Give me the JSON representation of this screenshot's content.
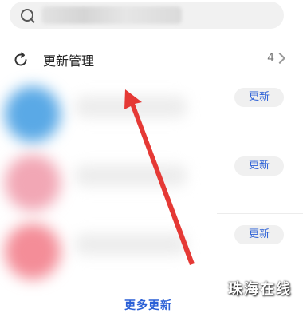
{
  "search": {
    "icon": "search-icon"
  },
  "manage": {
    "icon": "refresh-icon",
    "title": "更新管理",
    "count": "4",
    "chevron": "chevron-right-icon"
  },
  "apps": [
    {
      "button_label": "更新",
      "icon_color": "#5aa9e6"
    },
    {
      "button_label": "更新",
      "icon_color": "#f2a7b5"
    },
    {
      "button_label": "更新",
      "icon_color": "#f48d98"
    }
  ],
  "more_link": "更多更新",
  "watermark": "珠海在线",
  "annotation": {
    "arrow_color": "#e53935"
  }
}
